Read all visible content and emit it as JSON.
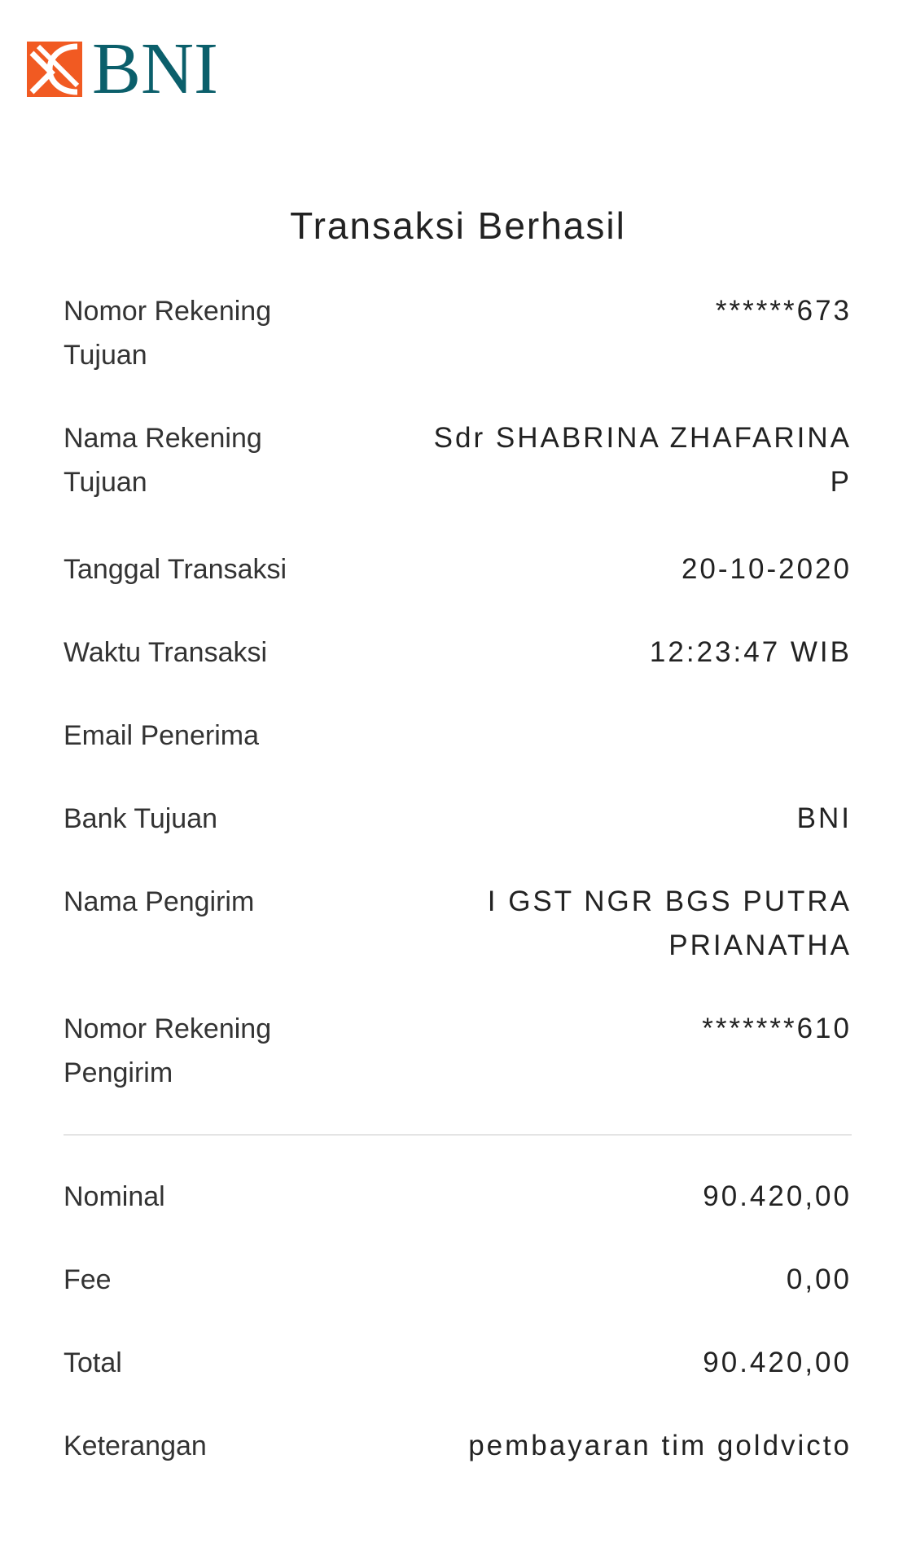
{
  "brand": {
    "logo_text": "BNI",
    "logo_icon": "bni-logo-icon",
    "primary_color": "#0b5f6b",
    "accent_color": "#f15a22"
  },
  "title": "Transaksi Berhasil",
  "details": [
    {
      "label": "Nomor Rekening Tujuan",
      "value": "******673"
    },
    {
      "label": "Nama Rekening Tujuan",
      "value": "Sdr SHABRINA ZHAFARINA P"
    },
    {
      "label": "Tanggal Transaksi",
      "value": "20-10-2020"
    },
    {
      "label": "Waktu Transaksi",
      "value": "12:23:47 WIB"
    },
    {
      "label": "Email Penerima",
      "value": ""
    },
    {
      "label": "Bank Tujuan",
      "value": "BNI"
    },
    {
      "label": "Nama Pengirim",
      "value": "I GST NGR BGS PUTRA PRIANATHA"
    },
    {
      "label": "Nomor Rekening Pengirim",
      "value": "*******610"
    }
  ],
  "amounts": [
    {
      "label": "Nominal",
      "value": "90.420,00"
    },
    {
      "label": "Fee",
      "value": "0,00"
    },
    {
      "label": "Total",
      "value": "90.420,00"
    },
    {
      "label": "Keterangan",
      "value": "pembayaran tim goldvicto"
    }
  ]
}
